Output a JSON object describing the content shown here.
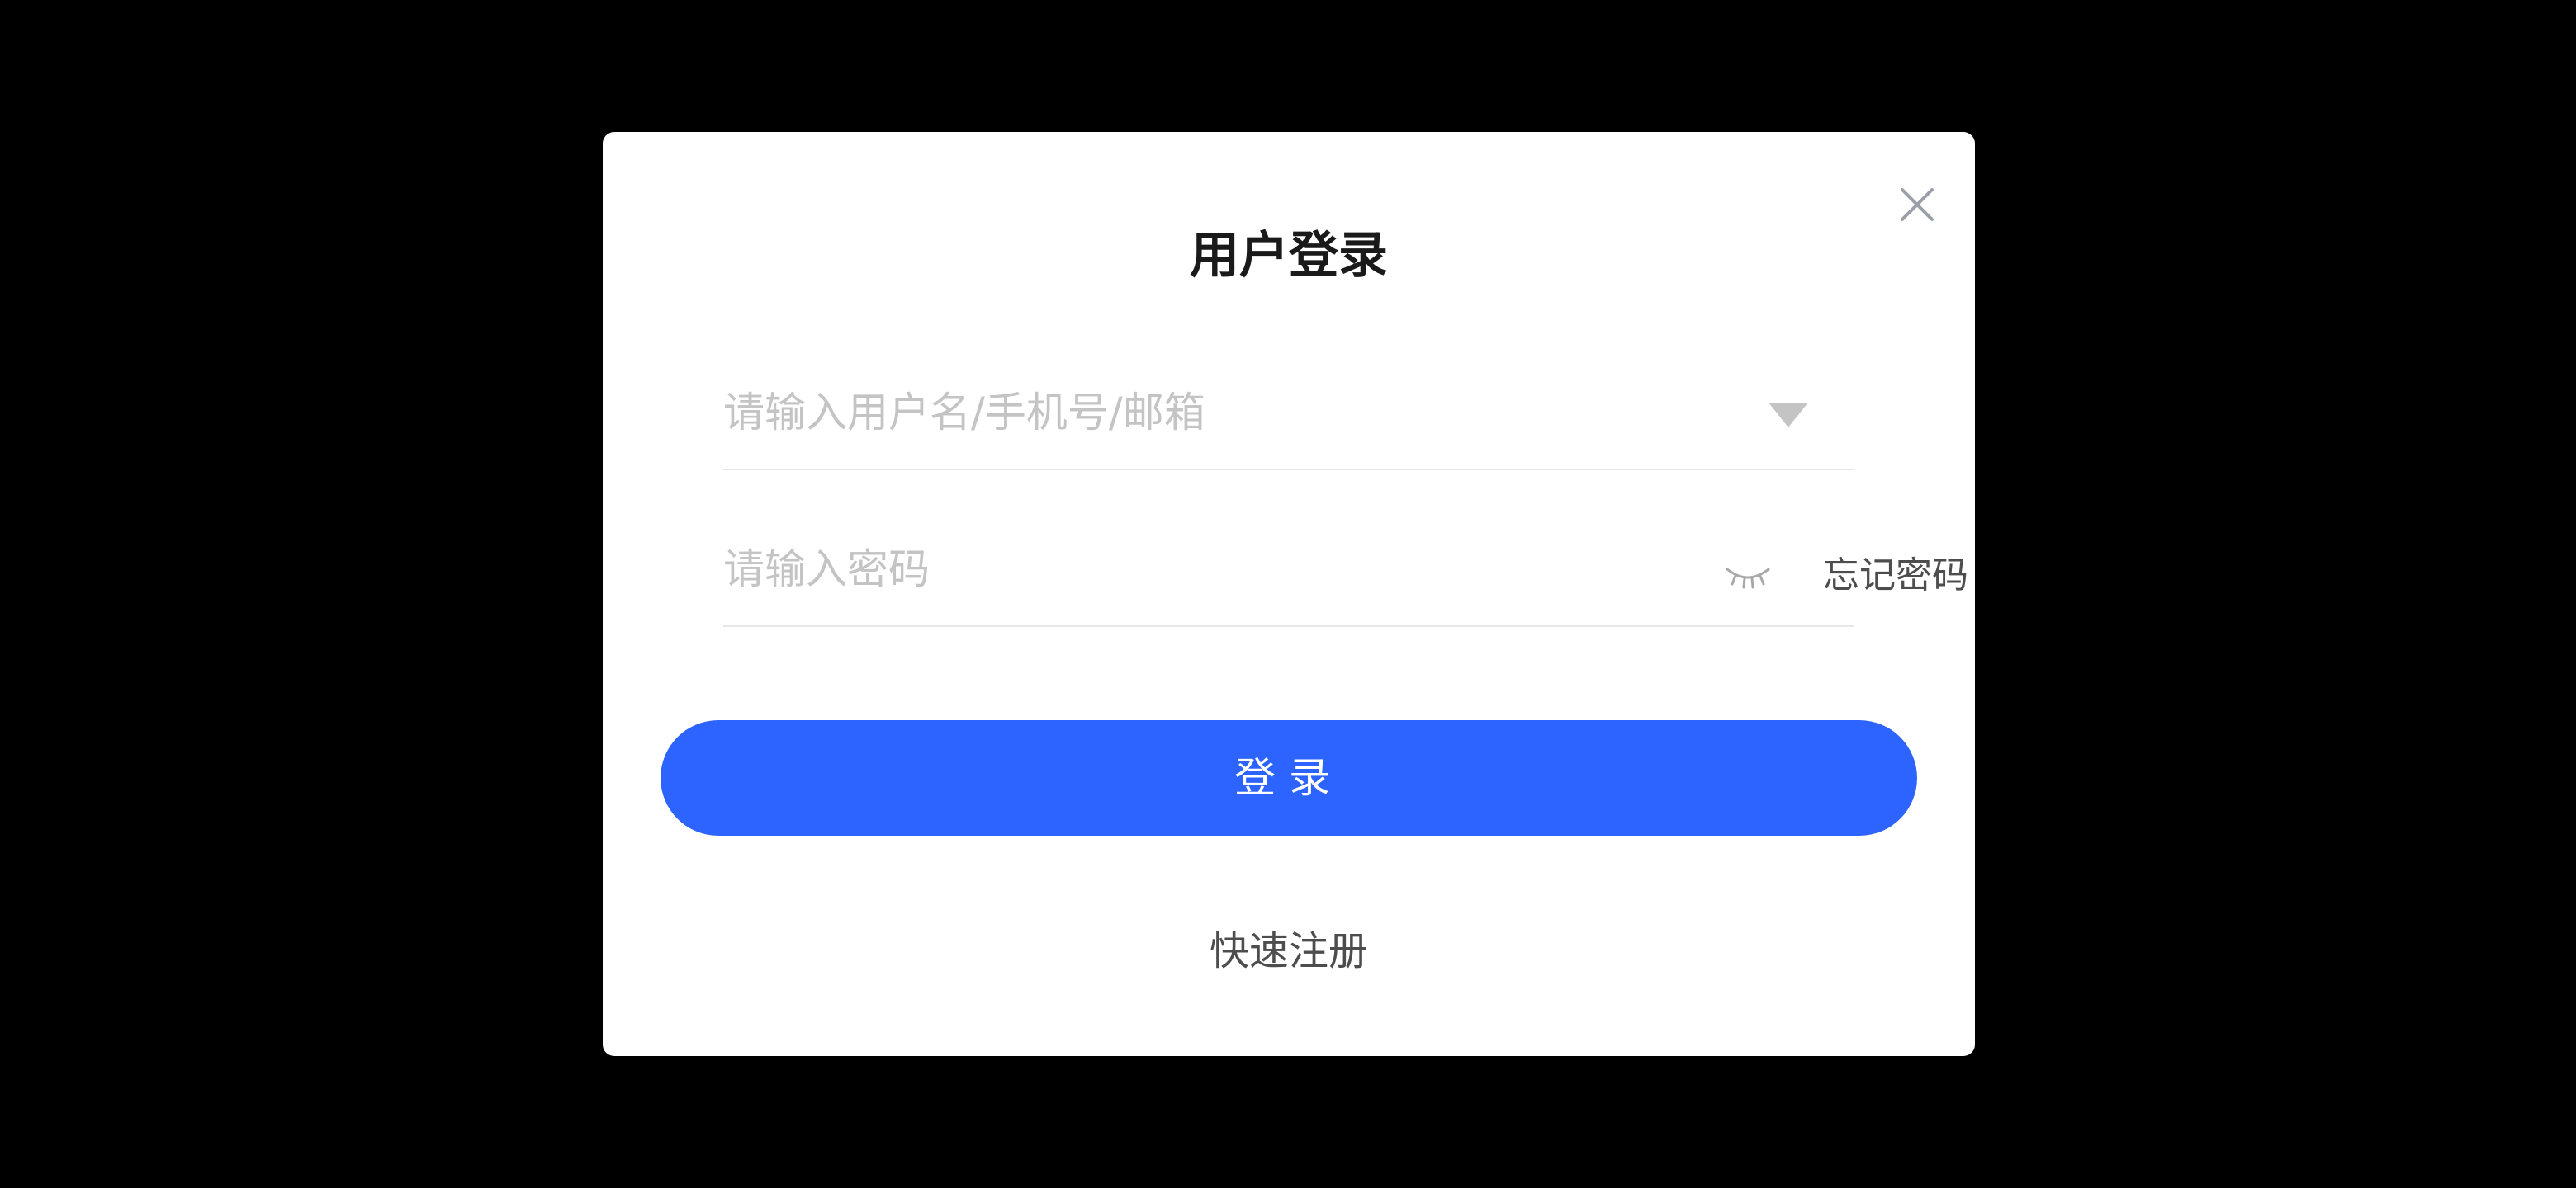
{
  "dialog": {
    "title": "用户登录",
    "close_icon": "close-icon"
  },
  "username": {
    "value": "",
    "placeholder": "请输入用户名/手机号/邮箱",
    "dropdown_icon": "caret-down-icon"
  },
  "password": {
    "value": "",
    "placeholder": "请输入密码",
    "visibility_icon": "eye-closed-icon",
    "forgot_label": "忘记密码"
  },
  "actions": {
    "login_label": "登录",
    "register_label": "快速注册"
  },
  "colors": {
    "backdrop": "#000000",
    "dialog": "#ffffff",
    "primary": "#2d63ff",
    "placeholder": "#c4c4c4",
    "divider": "#e6e6e6",
    "icon": "#9aa0a8"
  }
}
